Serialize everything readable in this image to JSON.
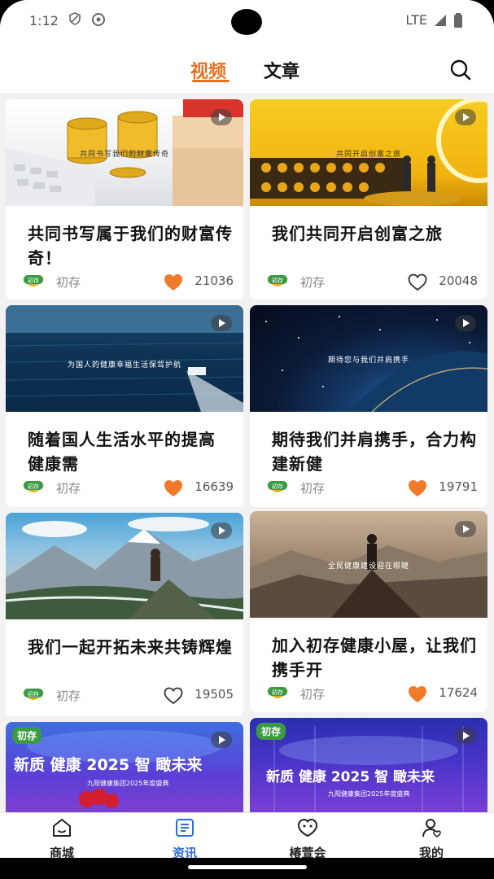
{
  "status_bar": {
    "time": "1:12",
    "network": "LTE"
  },
  "tabs": {
    "video": "视频",
    "article": "文章"
  },
  "cards": [
    {
      "title": "共同书写属于我们的财富传奇！",
      "overlay": "共同书写我们的财富传奇",
      "author": "初存",
      "likes": "21036",
      "liked": true
    },
    {
      "title": "我们共同开启创富之旅",
      "overlay": "共同开启创富之旅",
      "author": "初存",
      "likes": "20048",
      "liked": false
    },
    {
      "title": "随着国人生活水平的提高 健康需",
      "overlay": "为国人的健康幸福生活保驾护航",
      "author": "初存",
      "likes": "16639",
      "liked": true
    },
    {
      "title": "期待我们并肩携手，合力构建新健",
      "overlay": "期待您与我们并肩携手",
      "author": "初存",
      "likes": "19791",
      "liked": true
    },
    {
      "title": "我们一起开拓未来共铸辉煌",
      "overlay": "",
      "author": "初存",
      "likes": "19505",
      "liked": false
    },
    {
      "title": "加入初存健康小屋，让我们携手开",
      "overlay": "全民健康建设迎在眼睫",
      "author": "初存",
      "likes": "17624",
      "liked": true
    },
    {
      "banner_badge": "初存",
      "banner_text": "新质 健康 2025 智 瞰未来",
      "banner_sub": "九阳健康集团2025年度盛典"
    },
    {
      "banner_badge": "初存",
      "banner_text": "新质 健康 2025 智 瞰未来",
      "banner_sub": "九阳健康集团2025年度盛典"
    }
  ],
  "bottom_nav": [
    {
      "label": "商城",
      "icon": "home-icon"
    },
    {
      "label": "资讯",
      "icon": "news-icon",
      "active": true
    },
    {
      "label": "椿萱会",
      "icon": "community-icon"
    },
    {
      "label": "我的",
      "icon": "profile-icon"
    }
  ],
  "colors": {
    "accent": "#e8711e",
    "nav_active": "#2c6dd6",
    "heart": "#f07a28"
  }
}
